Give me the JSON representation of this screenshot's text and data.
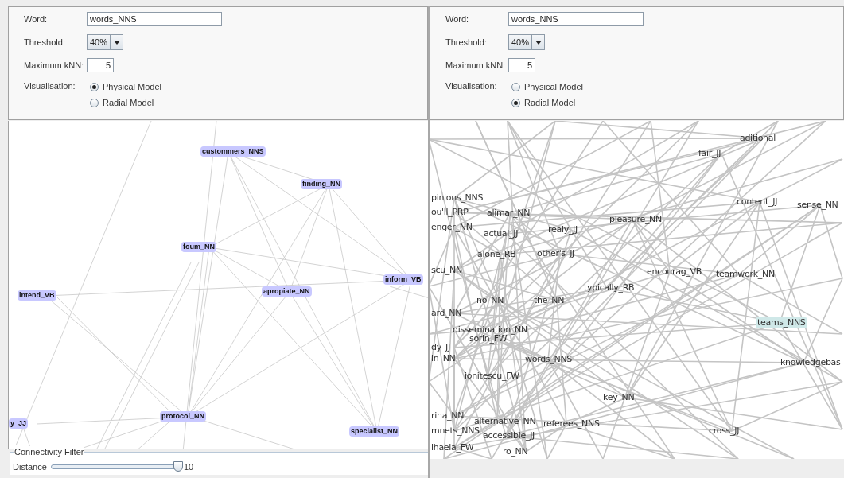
{
  "panels": [
    {
      "word": {
        "label": "Word:",
        "value": "words_NNS"
      },
      "threshold": {
        "label": "Threshold:",
        "value": "40%"
      },
      "knn": {
        "label": "Maximum kNN:",
        "value": "5"
      },
      "visualisation": {
        "label": "Visualisation:",
        "options": [
          {
            "label": "Physical Model",
            "selected": true
          },
          {
            "label": "Radial Model",
            "selected": false
          }
        ]
      },
      "graph": {
        "kind": "physical",
        "nodes": [
          {
            "label": "custommers_NNS",
            "highlighted": true
          },
          {
            "label": "finding_NN",
            "highlighted": true
          },
          {
            "label": "foum_NN",
            "highlighted": true
          },
          {
            "label": "intend_VB",
            "highlighted": true
          },
          {
            "label": "apropiate_NN",
            "highlighted": true
          },
          {
            "label": "inform_VB",
            "highlighted": true
          },
          {
            "label": "protocol_NN",
            "highlighted": true
          },
          {
            "label": "specialist_NN",
            "highlighted": true
          },
          {
            "label": "y_JJ",
            "highlighted": true
          }
        ]
      },
      "connectivity_filter": {
        "title": "Connectivity Filter",
        "label": "Distance",
        "level": 0.97,
        "reading": "10"
      }
    },
    {
      "word": {
        "label": "Word:",
        "value": "words_NNS"
      },
      "threshold": {
        "label": "Threshold:",
        "value": "40%"
      },
      "knn": {
        "label": "Maximum kNN:",
        "value": "5"
      },
      "visualisation": {
        "label": "Visualisation:",
        "options": [
          {
            "label": "Physical Model",
            "selected": false
          },
          {
            "label": "Radial Model",
            "selected": true
          }
        ]
      },
      "graph": {
        "kind": "radial",
        "nodes": [
          {
            "label": "aditional",
            "highlighted": false
          },
          {
            "label": "fair_JJ",
            "highlighted": false
          },
          {
            "label": "content_JJ",
            "highlighted": false
          },
          {
            "label": "sense_NN",
            "highlighted": false
          },
          {
            "label": "pinions_NNS",
            "highlighted": false
          },
          {
            "label": "ou'll_PRP",
            "highlighted": false
          },
          {
            "label": "alimar_NN",
            "highlighted": false
          },
          {
            "label": "enger_NN",
            "highlighted": false
          },
          {
            "label": "actual_JJ",
            "highlighted": false
          },
          {
            "label": "realy_JJ",
            "highlighted": false
          },
          {
            "label": "pleasure_NN",
            "highlighted": false
          },
          {
            "label": "other's_JJ",
            "highlighted": false
          },
          {
            "label": "alone_RB",
            "highlighted": false
          },
          {
            "label": "scu_NN",
            "highlighted": false
          },
          {
            "label": "typically_RB",
            "highlighted": false
          },
          {
            "label": "encourag_VB",
            "highlighted": false
          },
          {
            "label": "teamwork_NN",
            "highlighted": false
          },
          {
            "label": "no_NN",
            "highlighted": false
          },
          {
            "label": "the_NN",
            "highlighted": false
          },
          {
            "label": "ard_NN",
            "highlighted": false
          },
          {
            "label": "dissemination_NN",
            "highlighted": false
          },
          {
            "label": "sorin_FW",
            "highlighted": false
          },
          {
            "label": "dy_JJ",
            "highlighted": false
          },
          {
            "label": "in_NN",
            "highlighted": false
          },
          {
            "label": "words_NNS",
            "highlighted": false
          },
          {
            "label": "ionitescu_FW",
            "highlighted": false
          },
          {
            "label": "key_NN",
            "highlighted": false
          },
          {
            "label": "teams_NNS",
            "highlighted": true
          },
          {
            "label": "knowledgebas",
            "highlighted": false
          },
          {
            "label": "rina_NN",
            "highlighted": false
          },
          {
            "label": "alternative_NN",
            "highlighted": false
          },
          {
            "label": "referees_NNS",
            "highlighted": false
          },
          {
            "label": "mnets_NNS",
            "highlighted": false
          },
          {
            "label": "accessible_JJ",
            "highlighted": false
          },
          {
            "label": "cross_JJ",
            "highlighted": false
          },
          {
            "label": "ihaela_FW",
            "highlighted": false
          },
          {
            "label": "ro_NN",
            "highlighted": false
          }
        ]
      }
    }
  ]
}
